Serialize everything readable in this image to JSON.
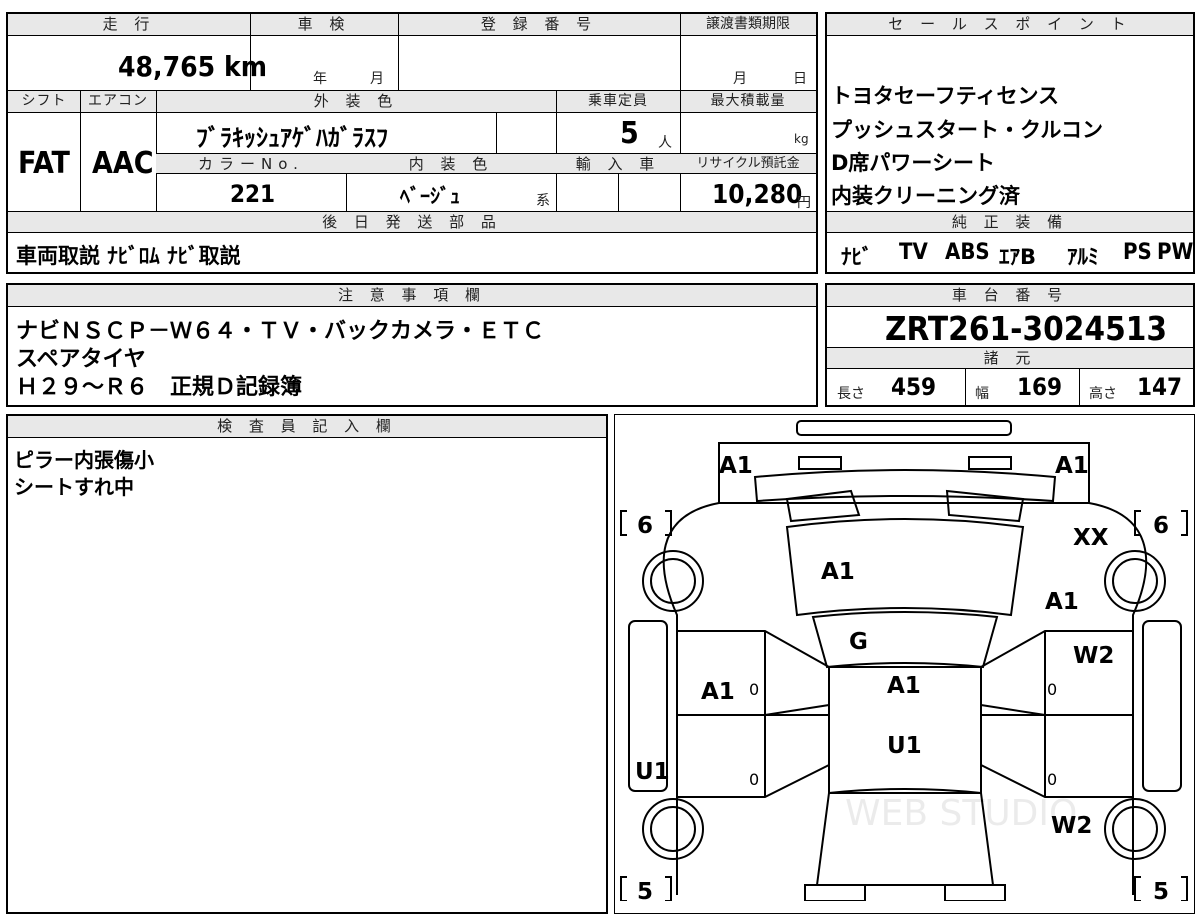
{
  "top_info": {
    "headers": {
      "mileage": "走 行",
      "inspection": "車 検",
      "reg_number": "登 録 番 号",
      "transfer_deadline": "譲渡書類期限"
    },
    "mileage_value": "48,765 km",
    "inspection_year_unit": "年",
    "inspection_month_unit": "月",
    "transfer_month_unit": "月",
    "transfer_day_unit": "日"
  },
  "spec_row": {
    "headers": {
      "shift": "シフト",
      "aircon": "エアコン",
      "exterior_color": "外 装 色",
      "capacity": "乗車定員",
      "max_load": "最大積載量"
    },
    "shift": "FAT",
    "aircon": "AAC",
    "exterior_color": "ﾌﾞﾗｷｯｼｭｱｹﾞﾊｶﾞﾗｽﾌ",
    "capacity": "5",
    "capacity_unit": "人",
    "load_unit": "kg"
  },
  "color_row": {
    "headers": {
      "color_no": "カラーNo.",
      "interior": "内 装 色",
      "import": "輸 入 車",
      "recycle": "リサイクル預託金"
    },
    "color_no": "221",
    "interior": "ﾍﾞｰｼﾞｭ",
    "interior_suffix": "系",
    "recycle_fee": "10,280",
    "recycle_unit": "円"
  },
  "later_parts": {
    "header": "後 日 発 送 部 品",
    "value": "車両取説 ﾅﾋﾞﾛﾑ ﾅﾋﾞ取説"
  },
  "sales_points": {
    "header": "セ ー ル ス ポ イ ン ト",
    "items": [
      "トヨタセーフティセンス",
      "プッシュスタート・クルコン",
      "D席パワーシート",
      "内装クリーニング済"
    ]
  },
  "genuine_equipment": {
    "header": "純 正 装 備",
    "items": [
      "ﾅﾋﾞ",
      "TV",
      "ABS",
      "ｴｱB",
      "ｱﾙﾐ",
      "PS",
      "PW"
    ]
  },
  "notes": {
    "header": "注 意 事 項 欄",
    "lines": [
      "ナビＮＳＣＰ－Ｗ６４・ＴＶ・バックカメラ・ＥＴＣ",
      "スペアタイヤ",
      "Ｈ２９～Ｒ６　正規Ｄ記録簿"
    ]
  },
  "chassis": {
    "header": "車 台 番 号",
    "value": "ZRT261-3024513"
  },
  "dimensions": {
    "header": "諸 元",
    "length_label": "長さ",
    "length": "459",
    "width_label": "幅",
    "width": "169",
    "height_label": "高さ",
    "height": "147"
  },
  "inspector": {
    "header": "検 査 員 記 入 欄",
    "lines": [
      "ピラー内張傷小",
      "シートすれ中"
    ]
  },
  "diagram": {
    "marks": {
      "front_left": "A1",
      "front_right": "A1",
      "tire_front_left": "6",
      "tire_front_right": "6",
      "tire_rear_left": "5",
      "tire_rear_right": "5",
      "right_fender_top": "XX",
      "hood": "A1",
      "right_fender": "A1",
      "windshield": "G",
      "right_front_door": "W2",
      "left_front_door": "A1",
      "roof": "A1",
      "roof_lower": "U1",
      "left_rocker": "U1",
      "right_rear": "W2",
      "zero": "0"
    },
    "watermark": "WEB STUDIO"
  }
}
